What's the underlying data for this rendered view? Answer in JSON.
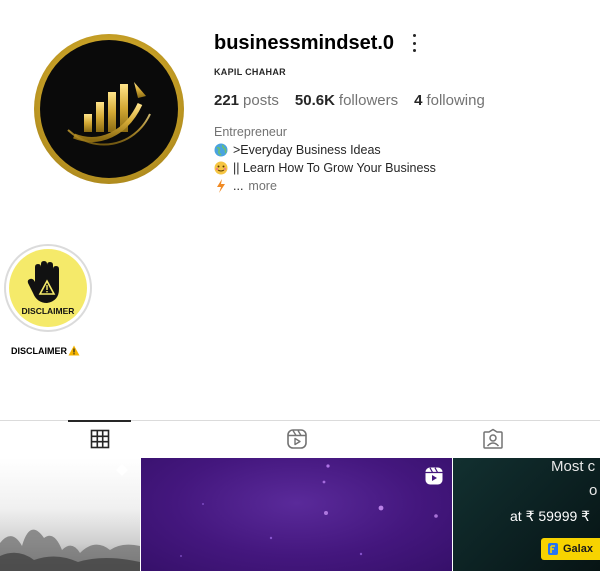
{
  "profile": {
    "username": "businessmindset.0",
    "full_name": "KAPIL CHAHAR",
    "posts_count": "221",
    "posts_label": "posts",
    "followers_count": "50.6K",
    "followers_label": "followers",
    "following_count": "4",
    "following_label": "following",
    "category": "Entrepreneur",
    "bio": [
      {
        "icon": "globe-emoji",
        "text": ">Everyday Business Ideas"
      },
      {
        "icon": "face-emoji",
        "text": "|| Learn How To Grow Your Business"
      },
      {
        "icon": "lightning-emoji",
        "text": "..."
      }
    ],
    "more_label": "more"
  },
  "highlights": [
    {
      "label": "DISCLAIMER",
      "badge_text": "DISCLAIMER",
      "icon": "warning-emoji"
    }
  ],
  "tabs": [
    {
      "name": "posts",
      "icon": "grid-icon",
      "active": true
    },
    {
      "name": "reels",
      "icon": "reels-icon",
      "active": false
    },
    {
      "name": "tagged",
      "icon": "tagged-icon",
      "active": false
    }
  ],
  "posts": {
    "tile3_line1": "Most c",
    "tile3_line2": "o",
    "tile3_price": "at ₹ 59999 ₹",
    "tile3_badge": "Galax"
  },
  "colors": {
    "gold": "#c9a227",
    "highlight_yellow": "#f5ea6a",
    "reel_purple": "#44177e",
    "badge_yellow": "#f7d300"
  }
}
